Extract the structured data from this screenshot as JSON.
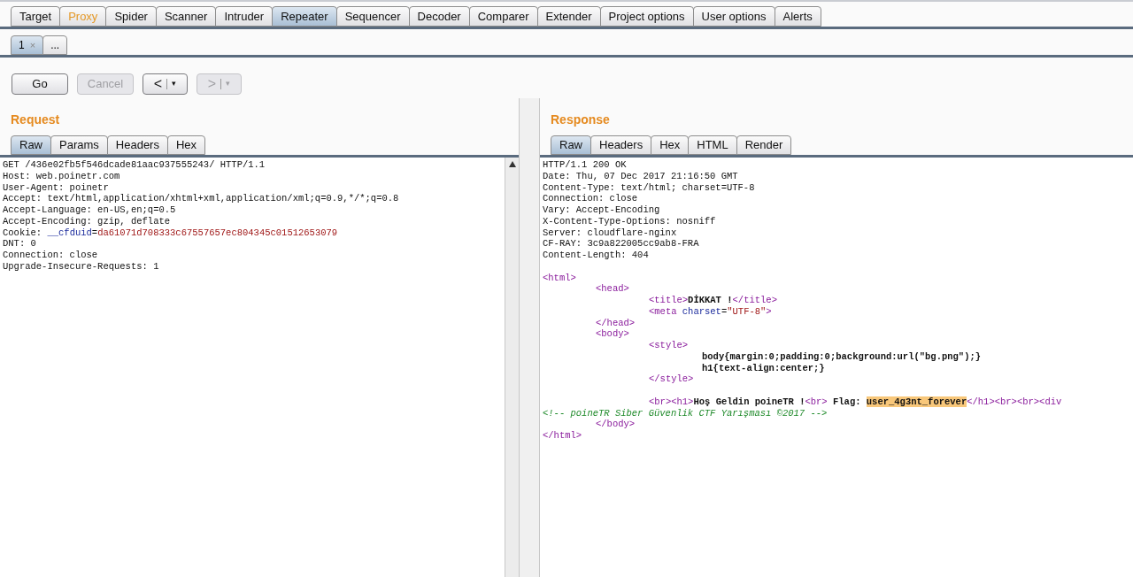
{
  "main_tabs": [
    {
      "label": "Target",
      "selected": false,
      "highlighted": false
    },
    {
      "label": "Proxy",
      "selected": false,
      "highlighted": true
    },
    {
      "label": "Spider",
      "selected": false,
      "highlighted": false
    },
    {
      "label": "Scanner",
      "selected": false,
      "highlighted": false
    },
    {
      "label": "Intruder",
      "selected": false,
      "highlighted": false
    },
    {
      "label": "Repeater",
      "selected": true,
      "highlighted": false
    },
    {
      "label": "Sequencer",
      "selected": false,
      "highlighted": false
    },
    {
      "label": "Decoder",
      "selected": false,
      "highlighted": false
    },
    {
      "label": "Comparer",
      "selected": false,
      "highlighted": false
    },
    {
      "label": "Extender",
      "selected": false,
      "highlighted": false
    },
    {
      "label": "Project options",
      "selected": false,
      "highlighted": false
    },
    {
      "label": "User options",
      "selected": false,
      "highlighted": false
    },
    {
      "label": "Alerts",
      "selected": false,
      "highlighted": false
    }
  ],
  "repeater_tabs": [
    {
      "label": "1",
      "close": "×",
      "selected": true
    },
    {
      "label": "...",
      "selected": false
    }
  ],
  "toolbar": [
    {
      "kind": "text",
      "label": "Go",
      "disabled": false
    },
    {
      "kind": "text",
      "label": "Cancel",
      "disabled": true
    },
    {
      "kind": "nav",
      "label": "<",
      "caret": "▾",
      "disabled": false
    },
    {
      "kind": "nav",
      "label": ">",
      "caret": "▾",
      "disabled": true
    }
  ],
  "request": {
    "title": "Request",
    "tabs": [
      {
        "label": "Raw",
        "selected": true
      },
      {
        "label": "Params",
        "selected": false
      },
      {
        "label": "Headers",
        "selected": false
      },
      {
        "label": "Hex",
        "selected": false
      }
    ],
    "lines": [
      {
        "segments": [
          {
            "kind": "plain",
            "text": "GET /436e02fb5f546dcade81aac937555243/ HTTP/1.1"
          }
        ]
      },
      {
        "segments": [
          {
            "kind": "plain",
            "text": "Host: web.poinetr.com"
          }
        ]
      },
      {
        "segments": [
          {
            "kind": "plain",
            "text": "User-Agent: poinetr"
          }
        ]
      },
      {
        "segments": [
          {
            "kind": "plain",
            "text": "Accept: text/html,application/xhtml+xml,application/xml;q=0.9,*/*;q=0.8"
          }
        ]
      },
      {
        "segments": [
          {
            "kind": "plain",
            "text": "Accept-Language: en-US,en;q=0.5"
          }
        ]
      },
      {
        "segments": [
          {
            "kind": "plain",
            "text": "Accept-Encoding: gzip, deflate"
          }
        ]
      },
      {
        "segments": [
          {
            "kind": "plain",
            "text": "Cookie: "
          },
          {
            "kind": "name",
            "text": "__cfduid"
          },
          {
            "kind": "plain",
            "text": "="
          },
          {
            "kind": "value",
            "text": "da61071d708333c67557657ec804345c01512653079"
          }
        ]
      },
      {
        "segments": [
          {
            "kind": "plain",
            "text": "DNT: 0"
          }
        ]
      },
      {
        "segments": [
          {
            "kind": "plain",
            "text": "Connection: close"
          }
        ]
      },
      {
        "segments": [
          {
            "kind": "plain",
            "text": "Upgrade-Insecure-Requests: 1"
          }
        ]
      }
    ]
  },
  "response": {
    "title": "Response",
    "tabs": [
      {
        "label": "Raw",
        "selected": true
      },
      {
        "label": "Headers",
        "selected": false
      },
      {
        "label": "Hex",
        "selected": false
      },
      {
        "label": "HTML",
        "selected": false
      },
      {
        "label": "Render",
        "selected": false
      }
    ],
    "lines": [
      {
        "segments": [
          {
            "kind": "plain",
            "text": "HTTP/1.1 200 OK"
          }
        ]
      },
      {
        "segments": [
          {
            "kind": "plain",
            "text": "Date: Thu, 07 Dec 2017 21:16:50 GMT"
          }
        ]
      },
      {
        "segments": [
          {
            "kind": "plain",
            "text": "Content-Type: text/html; charset=UTF-8"
          }
        ]
      },
      {
        "segments": [
          {
            "kind": "plain",
            "text": "Connection: close"
          }
        ]
      },
      {
        "segments": [
          {
            "kind": "plain",
            "text": "Vary: Accept-Encoding"
          }
        ]
      },
      {
        "segments": [
          {
            "kind": "plain",
            "text": "X-Content-Type-Options: nosniff"
          }
        ]
      },
      {
        "segments": [
          {
            "kind": "plain",
            "text": "Server: cloudflare-nginx"
          }
        ]
      },
      {
        "segments": [
          {
            "kind": "plain",
            "text": "CF-RAY: 3c9a822005cc9ab8-FRA"
          }
        ]
      },
      {
        "segments": [
          {
            "kind": "plain",
            "text": "Content-Length: 404"
          }
        ]
      },
      {
        "kind": "blank"
      },
      {
        "segments": [
          {
            "kind": "tag",
            "text": "<html>"
          }
        ]
      },
      {
        "kind": "indent1",
        "segments": [
          {
            "kind": "tag",
            "text": "<head>"
          }
        ]
      },
      {
        "kind": "indent2",
        "segments": [
          {
            "kind": "tag",
            "text": "<title>"
          },
          {
            "kind": "bold",
            "text": "DİKKAT !"
          },
          {
            "kind": "tag",
            "text": "</title>"
          }
        ]
      },
      {
        "kind": "indent2",
        "segments": [
          {
            "kind": "tag",
            "text": "<meta "
          },
          {
            "kind": "name",
            "text": "charset"
          },
          {
            "kind": "plain",
            "text": "="
          },
          {
            "kind": "value",
            "text": "\"UTF-8\""
          },
          {
            "kind": "tag",
            "text": ">"
          }
        ]
      },
      {
        "kind": "indent1",
        "segments": [
          {
            "kind": "tag",
            "text": "</head>"
          }
        ]
      },
      {
        "kind": "indent1",
        "segments": [
          {
            "kind": "tag",
            "text": "<body>"
          }
        ]
      },
      {
        "kind": "indent2",
        "segments": [
          {
            "kind": "tag",
            "text": "<style>"
          }
        ]
      },
      {
        "kind": "indent3",
        "segments": [
          {
            "kind": "bold",
            "text": "body{margin:0;padding:0;background:url(\"bg.png\");}"
          }
        ]
      },
      {
        "kind": "indent3",
        "segments": [
          {
            "kind": "bold",
            "text": "h1{text-align:center;}"
          }
        ]
      },
      {
        "kind": "indent2",
        "segments": [
          {
            "kind": "tag",
            "text": "</style>"
          }
        ]
      },
      {
        "kind": "blank"
      },
      {
        "kind": "indent2",
        "segments": [
          {
            "kind": "tag",
            "text": "<br><h1>"
          },
          {
            "kind": "bold",
            "text": "Hoş Geldin poineTR !"
          },
          {
            "kind": "tag",
            "text": "<br>"
          },
          {
            "kind": "bold",
            "text": " Flag: "
          },
          {
            "kind": "highlight",
            "text": "user_4g3nt_forever"
          },
          {
            "kind": "tag",
            "text": "</h1><br><br><div"
          }
        ]
      },
      {
        "segments": [
          {
            "kind": "comment",
            "text": "<!-- poineTR Siber Güvenlik CTF Yarışması ©2017 -->"
          }
        ]
      },
      {
        "kind": "indent1",
        "segments": [
          {
            "kind": "tag",
            "text": "</body>"
          }
        ]
      },
      {
        "segments": [
          {
            "kind": "tag",
            "text": "</html>"
          }
        ]
      }
    ]
  }
}
